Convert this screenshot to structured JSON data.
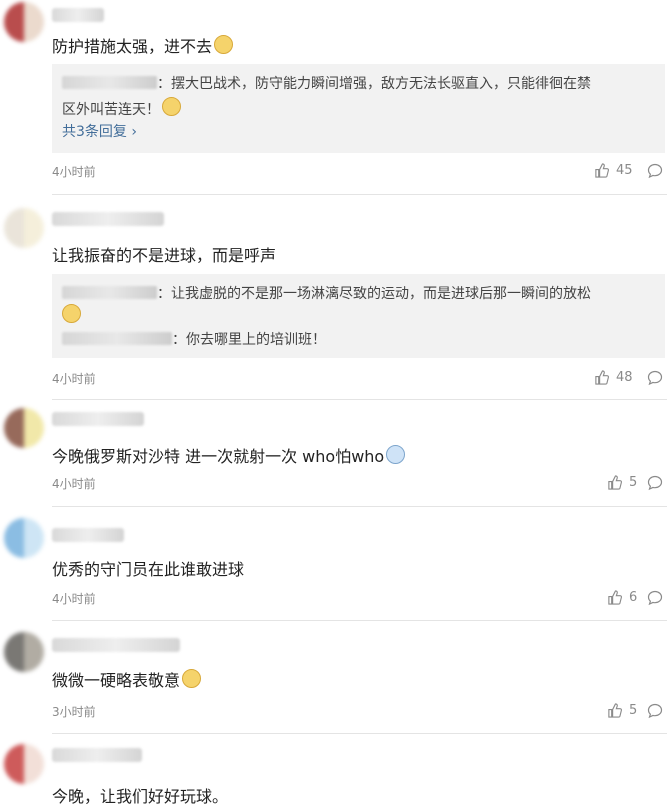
{
  "comments": [
    {
      "text": "防护措施太强，进不去",
      "emoji": "doge-emoji",
      "replies": [
        {
          "text": "：摆大巴战术，防守能力瞬间增强，敌方无法长驱直入，只能徘徊在禁",
          "text2": "区外叫苦连天！"
        }
      ],
      "more": "共3条回复",
      "time": "4小时前",
      "likes": "45"
    },
    {
      "text": "让我振奋的不是进球，而是呼声",
      "replies": [
        {
          "text": "：让我虚脱的不是那一场淋漓尽致的运动，而是进球后那一瞬间的放松"
        },
        {
          "text": "：你去哪里上的培训班！"
        }
      ],
      "time": "4小时前",
      "likes": "48"
    },
    {
      "text": "今晚俄罗斯对沙特 进一次就射一次 who怕who",
      "time": "4小时前",
      "likes": "5"
    },
    {
      "text": "优秀的守门员在此谁敢进球",
      "time": "4小时前",
      "likes": "6"
    },
    {
      "text": "微微一硬略表敬意",
      "time": "3小时前",
      "likes": "5"
    },
    {
      "text": "今晚，让我们好好玩球。"
    }
  ],
  "colors": {
    "link": "#436e9a",
    "meta": "#8a8a8a",
    "reply_bg": "#f2f2f2"
  },
  "icons": {
    "like": "thumbs-up-icon",
    "reply": "speech-bubble-icon",
    "emoji": "doge-emoji"
  }
}
